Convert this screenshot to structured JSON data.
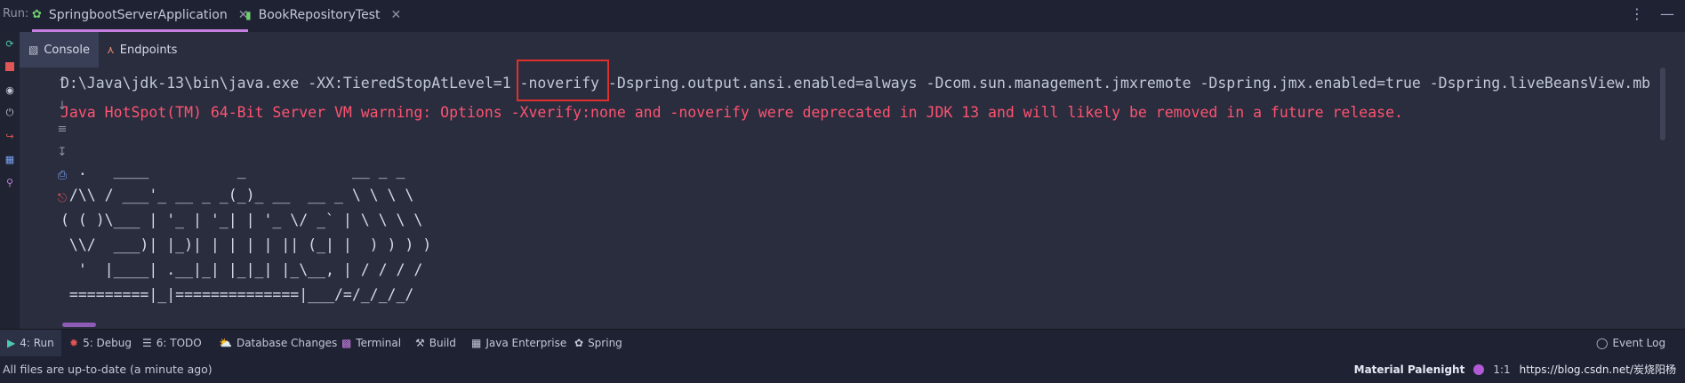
{
  "run_label": "Run:",
  "tabs": [
    {
      "label": "SpringbootServerApplication",
      "icon": "spring-run-icon",
      "active": true
    },
    {
      "label": "BookRepositoryTest",
      "icon": "test-class-icon",
      "active": false
    }
  ],
  "subtabs": [
    {
      "label": "Console",
      "icon": "console-icon",
      "active": true
    },
    {
      "label": "Endpoints",
      "icon": "endpoints-icon",
      "active": false
    }
  ],
  "console": {
    "command": "D:\\Java\\jdk-13\\bin\\java.exe -XX:TieredStopAtLevel=1 -noverify -Dspring.output.ansi.enabled=always -Dcom.sun.management.jmxremote -Dspring.jmx.enabled=true -Dspring.liveBeansView.mb",
    "warning": "Java HotSpot(TM) 64-Bit Server VM warning: Options -Xverify:none and -noverify were deprecated in JDK 13 and will likely be removed in a future release.",
    "ascii_banner": [
      "  .   ____          _            __ _ _",
      " /\\\\ / ___'_ __ _ _(_)_ __  __ _ \\ \\ \\ \\",
      "( ( )\\___ | '_ | '_| | '_ \\/ _` | \\ \\ \\ \\",
      " \\\\/  ___)| |_)| | | | | || (_| |  ) ) ) )",
      "  '  |____| .__|_| |_|_| |_\\__, | / / / /",
      " =========|_|==============|___/=/_/_/_/"
    ],
    "highlighted_text": "-noverify"
  },
  "bottom_tools": [
    {
      "label": "4: Run",
      "icon": "run-icon",
      "active": true
    },
    {
      "label": "5: Debug",
      "icon": "debug-icon",
      "active": false
    },
    {
      "label": "6: TODO",
      "icon": "todo-icon",
      "active": false
    },
    {
      "label": "Database Changes",
      "icon": "database-icon",
      "active": false
    },
    {
      "label": "Terminal",
      "icon": "terminal-icon",
      "active": false
    },
    {
      "label": "Build",
      "icon": "build-icon",
      "active": false
    },
    {
      "label": "Java Enterprise",
      "icon": "java-enterprise-icon",
      "active": false
    },
    {
      "label": "Spring",
      "icon": "spring-icon",
      "active": false
    },
    {
      "label": "Event Log",
      "icon": "event-log-icon",
      "active": false
    }
  ],
  "status": {
    "message": "All files are up-to-date (a minute ago)",
    "theme": "Material Palenight",
    "position": "1:1",
    "watermark": "https://blog.csdn.net/炭烧阳杨"
  },
  "colors": {
    "background": "#292d3e",
    "warning": "#ff5370",
    "accent": "#c57fe0",
    "highlight_border": "#e0302c"
  }
}
